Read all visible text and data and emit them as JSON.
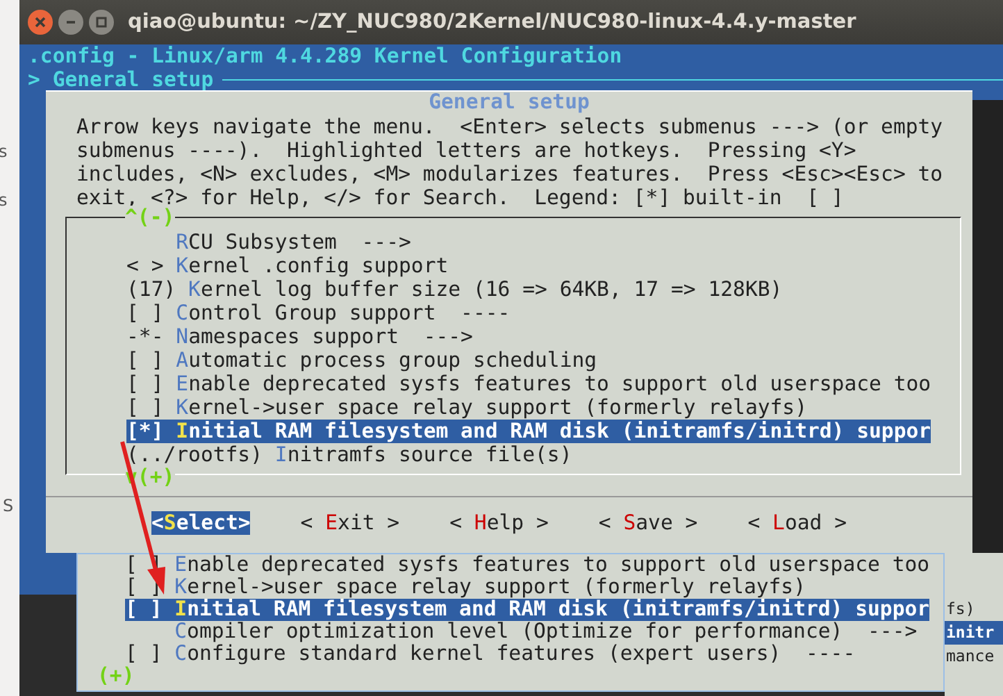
{
  "side_fragments": [
    "s",
    "s",
    "S"
  ],
  "terminal": {
    "title": "qiao@ubuntu: ~/ZY_NUC980/2Kernel/NUC980-linux-4.4.y-master",
    "header": ".config - Linux/arm 4.4.289 Kernel Configuration",
    "breadcrumb": "> General setup"
  },
  "dialog": {
    "title": "General setup",
    "help_lines": [
      "Arrow keys navigate the menu.  <Enter> selects submenus ---> (or empty",
      "submenus ----).  Highlighted letters are hotkeys.  Pressing <Y>",
      "includes, <N> excludes, <M> modularizes features.  Press <Esc><Esc> to",
      "exit, <?> for Help, </> for Search.  Legend: [*] built-in  [ ]"
    ],
    "scroll_up": "^(-)",
    "items": [
      {
        "label": "RCU Subsystem  --->",
        "selected": false
      },
      {
        "prefix": "< > ",
        "label": "Kernel .config support",
        "selected": false
      },
      {
        "prefix": "(17) ",
        "label": "Kernel log buffer size (16 => 64KB, 17 => 128KB)",
        "selected": false
      },
      {
        "prefix": "[ ] ",
        "label": "Control Group support  ----",
        "selected": false
      },
      {
        "prefix": "-*- ",
        "label": "Namespaces support  --->",
        "selected": false
      },
      {
        "prefix": "[ ] ",
        "label": "Automatic process group scheduling",
        "selected": false
      },
      {
        "prefix": "[ ] ",
        "label": "Enable deprecated sysfs features to support old userspace too",
        "selected": false
      },
      {
        "prefix": "[ ] ",
        "label": "Kernel->user space relay support (formerly relayfs)",
        "selected": false
      },
      {
        "prefix": "[*] ",
        "label": "Initial RAM filesystem and RAM disk (initramfs/initrd) suppor",
        "selected": true
      },
      {
        "prefix": "(../rootfs) ",
        "label": "Initramfs source file(s)",
        "selected": false
      }
    ],
    "scroll_down": "v(+)",
    "buttons": [
      {
        "label": "<Select>",
        "selected": true
      },
      {
        "label": "< Exit >",
        "selected": false
      },
      {
        "label": "< Help >",
        "selected": false
      },
      {
        "label": "< Save >",
        "selected": false
      },
      {
        "label": "< Load >",
        "selected": false
      }
    ]
  },
  "overlay": {
    "items": [
      {
        "prefix": "[ ] ",
        "label": "Enable deprecated sysfs features to support old userspace too",
        "selected": false
      },
      {
        "prefix": "[ ] ",
        "label": "Kernel->user space relay support (formerly relayfs)",
        "selected": false
      },
      {
        "prefix": "[ ] ",
        "label": "Initial RAM filesystem and RAM disk (initramfs/initrd) suppor",
        "selected": true
      },
      {
        "label": "Compiler optimization level (Optimize for performance)  --->",
        "selected": false
      },
      {
        "prefix": "[ ] ",
        "label": "Configure standard kernel features (expert users)  ----",
        "selected": false
      }
    ],
    "scroll_down": "(+)"
  },
  "behind_fragments": [
    {
      "text": "fs)",
      "selected": false
    },
    {
      "text": "initr",
      "selected": true
    },
    {
      "text": "mance",
      "selected": false
    }
  ]
}
